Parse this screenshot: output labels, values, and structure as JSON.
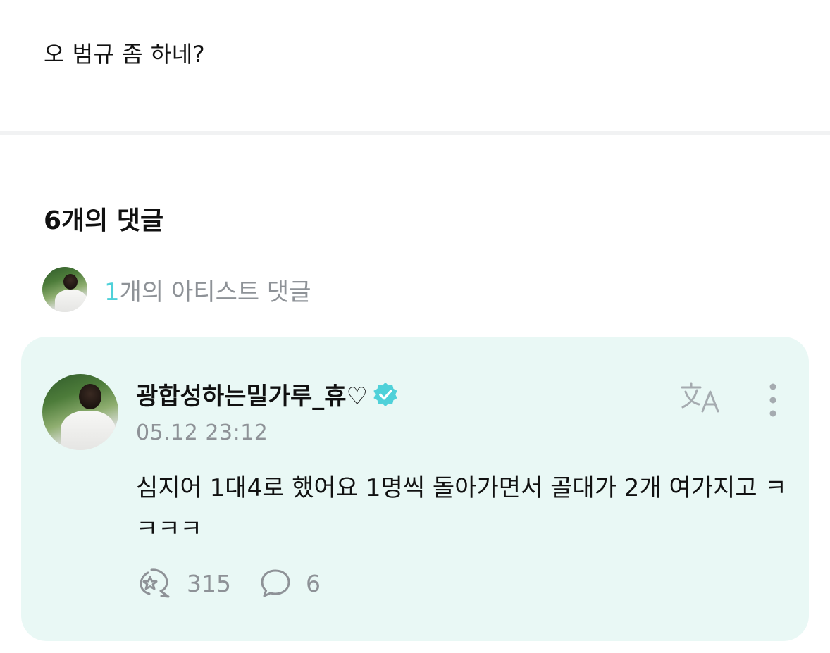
{
  "post": {
    "text": "오 범규 좀 하네?"
  },
  "comments_header": {
    "title": "6개의 댓글"
  },
  "artist_comments": {
    "count": "1",
    "label": "개의 아티스트 댓글"
  },
  "comment": {
    "author": "광합성하는밀가루_휴♡",
    "timestamp": "05.12 23:12",
    "body": "심지어 1대4로 했어요 1명씩 돌아가면서 골대가 2개 여가지고 ㅋㅋㅋㅋ",
    "likes": "315",
    "replies": "6"
  },
  "icons": {
    "verified": "verified-badge-icon",
    "translate": "translate-icon",
    "more": "more-vertical-icon",
    "like": "like-icon",
    "reply": "reply-bubble-icon"
  },
  "colors": {
    "accent": "#4fd1d9",
    "card_background": "#e9f8f5",
    "muted_text": "#8e9297"
  }
}
